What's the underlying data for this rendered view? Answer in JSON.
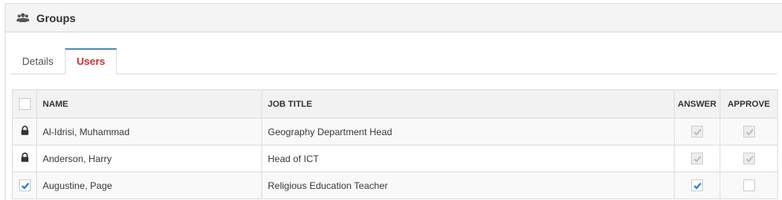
{
  "panel": {
    "title": "Groups",
    "icon": "users-icon"
  },
  "tabs": [
    {
      "label": "Details",
      "active": false
    },
    {
      "label": "Users",
      "active": true
    }
  ],
  "table": {
    "headers": {
      "name": "NAME",
      "job_title": "JOB TITLE",
      "answer": "ANSWER",
      "approve": "APPROVE"
    },
    "rows": [
      {
        "name": "Al-Idrisi, Muhammad",
        "job_title": "Geography Department Head",
        "row_state": "lock-icon",
        "answer": "checked-disabled",
        "approve": "checked-disabled"
      },
      {
        "name": "Anderson, Harry",
        "job_title": "Head of ICT",
        "row_state": "lock-icon",
        "answer": "checked-disabled",
        "approve": "checked-disabled"
      },
      {
        "name": "Augustine, Page",
        "job_title": "Religious Education Teacher",
        "row_state": "checked",
        "answer": "checked",
        "approve": "unchecked"
      }
    ]
  },
  "colors": {
    "accent_blue": "#2a7cc7",
    "active_tab_text": "#c7332e",
    "header_bg": "#f2f2f2"
  }
}
